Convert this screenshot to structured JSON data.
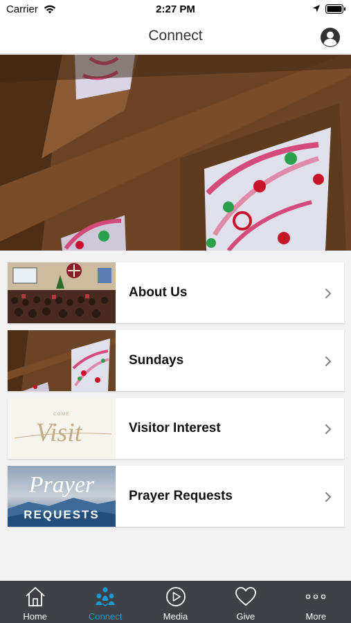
{
  "status": {
    "carrier": "Carrier",
    "time": "2:27 PM"
  },
  "nav": {
    "title": "Connect"
  },
  "items": [
    {
      "label": "About Us"
    },
    {
      "label": "Sundays"
    },
    {
      "label": "Visitor Interest",
      "thumb_small": "COME",
      "thumb_big": "Visit"
    },
    {
      "label": "Prayer Requests",
      "thumb_big": "Prayer",
      "thumb_small": "REQUESTS"
    }
  ],
  "tabs": [
    {
      "label": "Home",
      "icon": "home-icon"
    },
    {
      "label": "Connect",
      "icon": "people-icon",
      "active": true
    },
    {
      "label": "Media",
      "icon": "play-icon"
    },
    {
      "label": "Give",
      "icon": "heart-icon"
    },
    {
      "label": "More",
      "icon": "more-icon"
    }
  ],
  "colors": {
    "accent": "#1b9ad6",
    "tabbar": "#3e4247"
  }
}
